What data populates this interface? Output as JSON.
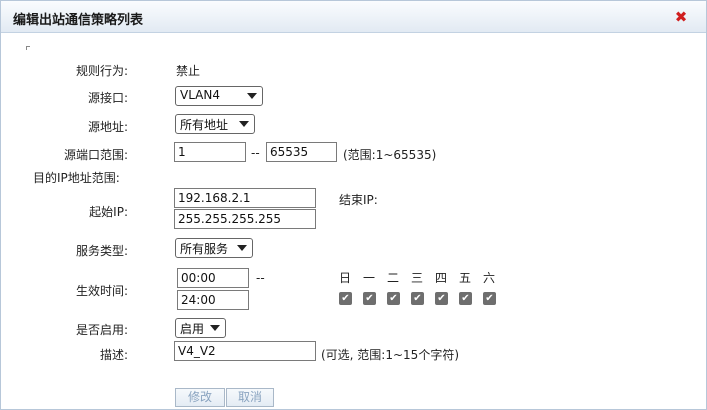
{
  "dialog": {
    "title": "编辑出站通信策略列表"
  },
  "form": {
    "rule_action": {
      "label": "规则行为:",
      "value": "禁止"
    },
    "src_interface": {
      "label": "源接口:",
      "value": "VLAN4"
    },
    "src_address": {
      "label": "源地址:",
      "value": "所有地址"
    },
    "src_port_range": {
      "label": "源端口范围:",
      "start": "1",
      "sep": "--",
      "end": "65535",
      "hint": "(范围:1~65535)"
    },
    "dest_ip_range": {
      "label": "目的IP地址范围:"
    },
    "start_ip": {
      "label": "起始IP:",
      "ip": "192.168.2.1",
      "mask": "255.255.255.255",
      "end_ip_label": "结束IP:"
    },
    "service_type": {
      "label": "服务类型:",
      "value": "所有服务"
    },
    "effective_time": {
      "label": "生效时间:",
      "start": "00:00",
      "sep": "--",
      "end": "24:00"
    },
    "weekdays": [
      "日",
      "一",
      "二",
      "三",
      "四",
      "五",
      "六"
    ],
    "weekday_checked": [
      true,
      true,
      true,
      true,
      true,
      true,
      true
    ],
    "enabled": {
      "label": "是否启用:",
      "value": "启用"
    },
    "description": {
      "label": "描述:",
      "value": "V4_V2",
      "hint": "(可选, 范围:1~15个字符)"
    }
  },
  "buttons": {
    "modify": "修改",
    "cancel": "取消"
  },
  "colors": {
    "close_icon": "#d01f1f",
    "checkbox": "#6e6e6e",
    "button_text": "#8aa4c0"
  }
}
